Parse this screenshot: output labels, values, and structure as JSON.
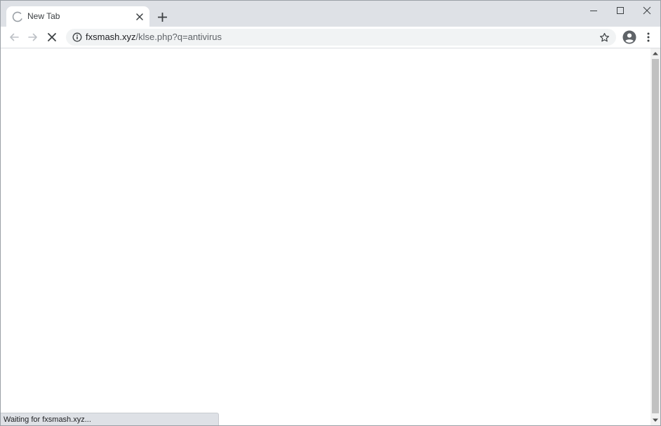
{
  "window": {
    "minimize_icon": "minimize-icon",
    "maximize_icon": "maximize-icon",
    "close_icon": "close-icon"
  },
  "tab": {
    "title": "New Tab",
    "loading_icon": "loading-spinner-icon",
    "close_icon": "close-icon"
  },
  "new_tab_icon": "plus-icon",
  "toolbar": {
    "back_icon": "arrow-left-icon",
    "forward_icon": "arrow-right-icon",
    "stop_icon": "stop-x-icon",
    "profile_icon": "account-circle-icon",
    "menu_icon": "kebab-menu-icon"
  },
  "omnibox": {
    "info_icon": "info-icon",
    "url_host": "fxsmash.xyz",
    "url_path": "/klse.php?q=antivirus",
    "bookmark_icon": "star-outline-icon"
  },
  "status": {
    "text": "Waiting for fxsmash.xyz..."
  },
  "colors": {
    "tabstrip_bg": "#dee1e6",
    "omnibox_bg": "#f1f3f4",
    "icon_color": "#5f6368",
    "throbber_color": "#1a73e8"
  }
}
